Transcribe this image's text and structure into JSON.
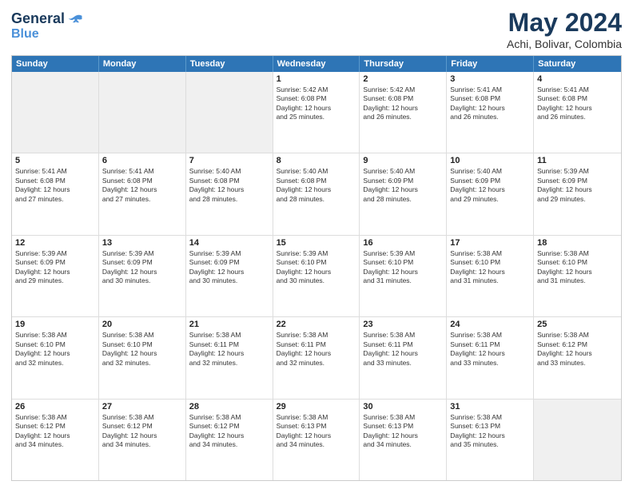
{
  "logo": {
    "line1": "General",
    "line2": "Blue"
  },
  "title": "May 2024",
  "subtitle": "Achi, Bolivar, Colombia",
  "weekdays": [
    "Sunday",
    "Monday",
    "Tuesday",
    "Wednesday",
    "Thursday",
    "Friday",
    "Saturday"
  ],
  "weeks": [
    [
      {
        "day": "",
        "text": ""
      },
      {
        "day": "",
        "text": ""
      },
      {
        "day": "",
        "text": ""
      },
      {
        "day": "1",
        "text": "Sunrise: 5:42 AM\nSunset: 6:08 PM\nDaylight: 12 hours\nand 25 minutes."
      },
      {
        "day": "2",
        "text": "Sunrise: 5:42 AM\nSunset: 6:08 PM\nDaylight: 12 hours\nand 26 minutes."
      },
      {
        "day": "3",
        "text": "Sunrise: 5:41 AM\nSunset: 6:08 PM\nDaylight: 12 hours\nand 26 minutes."
      },
      {
        "day": "4",
        "text": "Sunrise: 5:41 AM\nSunset: 6:08 PM\nDaylight: 12 hours\nand 26 minutes."
      }
    ],
    [
      {
        "day": "5",
        "text": "Sunrise: 5:41 AM\nSunset: 6:08 PM\nDaylight: 12 hours\nand 27 minutes."
      },
      {
        "day": "6",
        "text": "Sunrise: 5:41 AM\nSunset: 6:08 PM\nDaylight: 12 hours\nand 27 minutes."
      },
      {
        "day": "7",
        "text": "Sunrise: 5:40 AM\nSunset: 6:08 PM\nDaylight: 12 hours\nand 28 minutes."
      },
      {
        "day": "8",
        "text": "Sunrise: 5:40 AM\nSunset: 6:08 PM\nDaylight: 12 hours\nand 28 minutes."
      },
      {
        "day": "9",
        "text": "Sunrise: 5:40 AM\nSunset: 6:09 PM\nDaylight: 12 hours\nand 28 minutes."
      },
      {
        "day": "10",
        "text": "Sunrise: 5:40 AM\nSunset: 6:09 PM\nDaylight: 12 hours\nand 29 minutes."
      },
      {
        "day": "11",
        "text": "Sunrise: 5:39 AM\nSunset: 6:09 PM\nDaylight: 12 hours\nand 29 minutes."
      }
    ],
    [
      {
        "day": "12",
        "text": "Sunrise: 5:39 AM\nSunset: 6:09 PM\nDaylight: 12 hours\nand 29 minutes."
      },
      {
        "day": "13",
        "text": "Sunrise: 5:39 AM\nSunset: 6:09 PM\nDaylight: 12 hours\nand 30 minutes."
      },
      {
        "day": "14",
        "text": "Sunrise: 5:39 AM\nSunset: 6:09 PM\nDaylight: 12 hours\nand 30 minutes."
      },
      {
        "day": "15",
        "text": "Sunrise: 5:39 AM\nSunset: 6:10 PM\nDaylight: 12 hours\nand 30 minutes."
      },
      {
        "day": "16",
        "text": "Sunrise: 5:39 AM\nSunset: 6:10 PM\nDaylight: 12 hours\nand 31 minutes."
      },
      {
        "day": "17",
        "text": "Sunrise: 5:38 AM\nSunset: 6:10 PM\nDaylight: 12 hours\nand 31 minutes."
      },
      {
        "day": "18",
        "text": "Sunrise: 5:38 AM\nSunset: 6:10 PM\nDaylight: 12 hours\nand 31 minutes."
      }
    ],
    [
      {
        "day": "19",
        "text": "Sunrise: 5:38 AM\nSunset: 6:10 PM\nDaylight: 12 hours\nand 32 minutes."
      },
      {
        "day": "20",
        "text": "Sunrise: 5:38 AM\nSunset: 6:10 PM\nDaylight: 12 hours\nand 32 minutes."
      },
      {
        "day": "21",
        "text": "Sunrise: 5:38 AM\nSunset: 6:11 PM\nDaylight: 12 hours\nand 32 minutes."
      },
      {
        "day": "22",
        "text": "Sunrise: 5:38 AM\nSunset: 6:11 PM\nDaylight: 12 hours\nand 32 minutes."
      },
      {
        "day": "23",
        "text": "Sunrise: 5:38 AM\nSunset: 6:11 PM\nDaylight: 12 hours\nand 33 minutes."
      },
      {
        "day": "24",
        "text": "Sunrise: 5:38 AM\nSunset: 6:11 PM\nDaylight: 12 hours\nand 33 minutes."
      },
      {
        "day": "25",
        "text": "Sunrise: 5:38 AM\nSunset: 6:12 PM\nDaylight: 12 hours\nand 33 minutes."
      }
    ],
    [
      {
        "day": "26",
        "text": "Sunrise: 5:38 AM\nSunset: 6:12 PM\nDaylight: 12 hours\nand 34 minutes."
      },
      {
        "day": "27",
        "text": "Sunrise: 5:38 AM\nSunset: 6:12 PM\nDaylight: 12 hours\nand 34 minutes."
      },
      {
        "day": "28",
        "text": "Sunrise: 5:38 AM\nSunset: 6:12 PM\nDaylight: 12 hours\nand 34 minutes."
      },
      {
        "day": "29",
        "text": "Sunrise: 5:38 AM\nSunset: 6:13 PM\nDaylight: 12 hours\nand 34 minutes."
      },
      {
        "day": "30",
        "text": "Sunrise: 5:38 AM\nSunset: 6:13 PM\nDaylight: 12 hours\nand 34 minutes."
      },
      {
        "day": "31",
        "text": "Sunrise: 5:38 AM\nSunset: 6:13 PM\nDaylight: 12 hours\nand 35 minutes."
      },
      {
        "day": "",
        "text": ""
      }
    ]
  ]
}
